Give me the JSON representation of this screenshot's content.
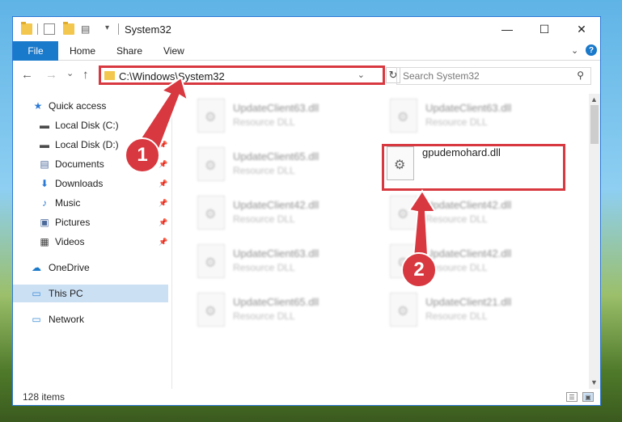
{
  "window": {
    "title": "System32",
    "controls": {
      "minimize": "—",
      "maximize": "☐",
      "close": "✕"
    }
  },
  "ribbon": {
    "tabs": [
      {
        "label": "File"
      },
      {
        "label": "Home"
      },
      {
        "label": "Share"
      },
      {
        "label": "View"
      }
    ],
    "help": "?"
  },
  "navigation": {
    "back": "←",
    "forward": "→",
    "recent": "⌄",
    "up": "↑",
    "address": "C:\\Windows\\System32",
    "refresh": "↻"
  },
  "search": {
    "placeholder": "Search System32",
    "icon": "search-icon"
  },
  "sidebar": {
    "items": [
      {
        "label": "Quick access",
        "icon": "star-icon",
        "glyph": "★",
        "color": "#2b79d6"
      },
      {
        "label": "Local Disk (C:)",
        "icon": "disk-icon",
        "glyph": "▬",
        "color": "#4b4b4b",
        "pinned": true
      },
      {
        "label": "Local Disk (D:)",
        "icon": "disk-icon",
        "glyph": "▬",
        "color": "#4b4b4b",
        "pinned": true
      },
      {
        "label": "Documents",
        "icon": "document-icon",
        "glyph": "▤",
        "color": "#4b6a9a",
        "pinned": true
      },
      {
        "label": "Downloads",
        "icon": "download-icon",
        "glyph": "⬇",
        "color": "#2b79d6",
        "pinned": true
      },
      {
        "label": "Music",
        "icon": "music-icon",
        "glyph": "♪",
        "color": "#2b79d6",
        "pinned": true
      },
      {
        "label": "Pictures",
        "icon": "pictures-icon",
        "glyph": "▣",
        "color": "#4b6a9a",
        "pinned": true
      },
      {
        "label": "Videos",
        "icon": "videos-icon",
        "glyph": "▦",
        "color": "#3b3b3b",
        "pinned": true
      },
      {
        "label": "OneDrive",
        "icon": "cloud-icon",
        "glyph": "☁",
        "color": "#1979ca"
      },
      {
        "label": "This PC",
        "icon": "computer-icon",
        "glyph": "▭",
        "color": "#3a8bd6",
        "selected": true
      },
      {
        "label": "Network",
        "icon": "network-icon",
        "glyph": "▭",
        "color": "#3a8bd6"
      }
    ],
    "pin_glyph": "📌"
  },
  "files": {
    "left_column": [
      {
        "name": "UpdateClient63.dll",
        "type": "Resource DLL"
      },
      {
        "name": "UpdateClient65.dll",
        "type": "Resource DLL"
      },
      {
        "name": "UpdateClient42.dll",
        "type": "Resource DLL"
      },
      {
        "name": "UpdateClient63.dll",
        "type": "Resource DLL"
      },
      {
        "name": "UpdateClient65.dll",
        "type": "Resource DLL"
      }
    ],
    "right_column": [
      {
        "name": "UpdateClient63.dll",
        "type": "Resource DLL"
      },
      {
        "name": "",
        "type": ""
      },
      {
        "name": "UpdateClient42.dll",
        "type": "Resource DLL"
      },
      {
        "name": "UpdateClient42.dll",
        "type": "Resource DLL"
      },
      {
        "name": "UpdateClient21.dll",
        "type": "Resource DLL"
      }
    ],
    "highlighted": {
      "name": "gpudemohard.dll"
    }
  },
  "callouts": {
    "step1": "1",
    "step2": "2"
  },
  "status": {
    "count": "128 items"
  },
  "colors": {
    "accent": "#1979ca",
    "annotation": "#d8383f"
  }
}
